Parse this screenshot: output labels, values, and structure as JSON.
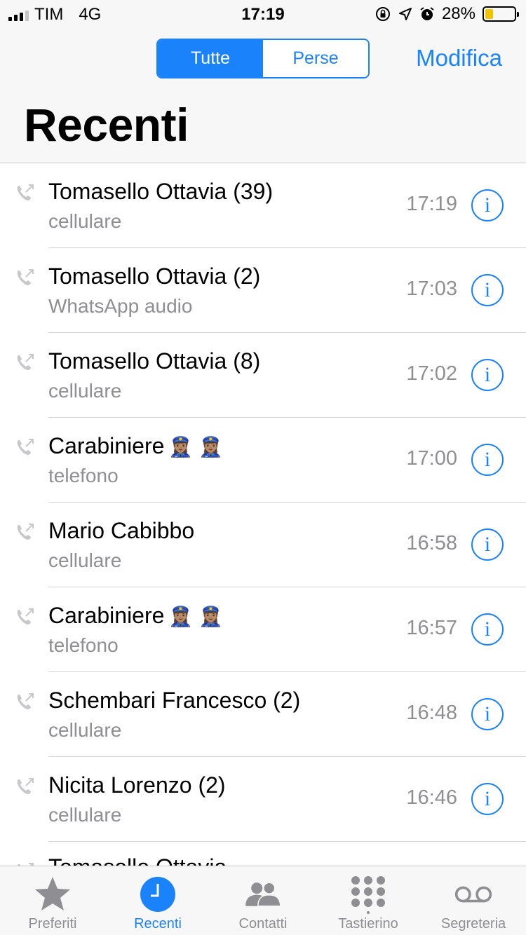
{
  "status_bar": {
    "carrier": "TIM",
    "network": "4G",
    "time": "17:19",
    "battery": "28%",
    "battery_level": 0.28
  },
  "nav": {
    "segments": [
      "Tutte",
      "Perse"
    ],
    "selected_segment": "Tutte",
    "edit_label": "Modifica",
    "title": "Recenti"
  },
  "calls": [
    {
      "name": "Tomasello Ottavia (39)",
      "type": "cellulare",
      "time": "17:19"
    },
    {
      "name": "Tomasello Ottavia (2)",
      "type": "WhatsApp audio",
      "time": "17:03"
    },
    {
      "name": "Tomasello Ottavia (8)",
      "type": "cellulare",
      "time": "17:02"
    },
    {
      "name": "Carabiniere",
      "emoji": "👮🏽‍♀️ 👮🏽‍♀️",
      "type": "telefono",
      "time": "17:00"
    },
    {
      "name": "Mario Cabibbo",
      "type": "cellulare",
      "time": "16:58"
    },
    {
      "name": "Carabiniere",
      "emoji": "👮🏽‍♀️ 👮🏽‍♀️",
      "type": "telefono",
      "time": "16:57"
    },
    {
      "name": "Schembari Francesco (2)",
      "type": "cellulare",
      "time": "16:48"
    },
    {
      "name": "Nicita Lorenzo (2)",
      "type": "cellulare",
      "time": "16:46"
    },
    {
      "name": "Tomasello Ottavia",
      "type": "",
      "time": ""
    }
  ],
  "info_glyph": "i",
  "tabbar": {
    "tabs": [
      {
        "label": "Preferiti",
        "icon": "star-icon"
      },
      {
        "label": "Recenti",
        "icon": "clock-icon"
      },
      {
        "label": "Contatti",
        "icon": "contacts-icon"
      },
      {
        "label": "Tastierino",
        "icon": "keypad-icon"
      },
      {
        "label": "Segreteria",
        "icon": "voicemail-icon"
      }
    ],
    "active": "Recenti"
  },
  "colors": {
    "accent": "#1a82fb",
    "secondary_text": "#8e8e93",
    "battery": "#f2c400"
  }
}
